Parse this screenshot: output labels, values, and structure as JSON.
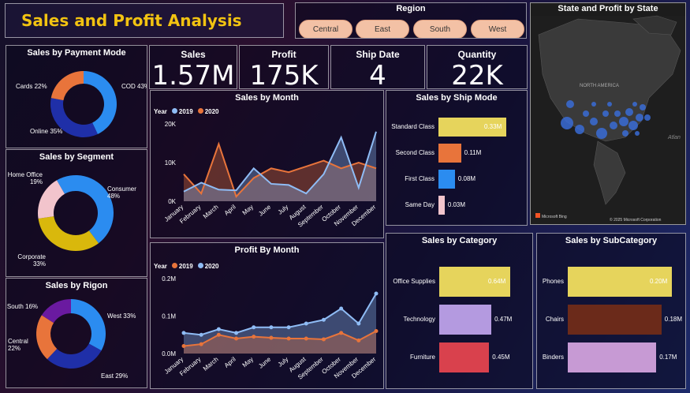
{
  "dashboard_title": "Sales and Profit Analysis",
  "region_slicer": {
    "title": "Region",
    "options": [
      "Central",
      "East",
      "South",
      "West"
    ]
  },
  "kpis": [
    {
      "label": "Sales",
      "value": "1.57M"
    },
    {
      "label": "Profit",
      "value": "175K"
    },
    {
      "label": "Ship Date",
      "value": "4"
    },
    {
      "label": "Quantity",
      "value": "22K"
    }
  ],
  "map": {
    "title": "State and Profit by State",
    "region_label": "NORTH AMERICA",
    "ocean_label": "Atlan",
    "attribution_left": "Microsoft Bing",
    "attribution_right": "© 2025 Microsoft Corporation"
  },
  "chart_data": [
    {
      "id": "payment_mode",
      "type": "pie",
      "title": "Sales by Payment Mode",
      "labels": [
        "COD",
        "Online",
        "Cards"
      ],
      "values": [
        43,
        35,
        22
      ],
      "label_text": [
        "COD 43%",
        "Online 35%",
        "Cards 22%"
      ],
      "colors": [
        "#2b8cf0",
        "#1f2fa8",
        "#e8743b"
      ]
    },
    {
      "id": "segment",
      "type": "pie",
      "title": "Sales by Segment",
      "labels": [
        "Consumer",
        "Corporate",
        "Home Office"
      ],
      "values": [
        48,
        33,
        19
      ],
      "label_text": [
        "Consumer\n48%",
        "Corporate\n33%",
        "Home Office\n19%"
      ],
      "colors": [
        "#2b8cf0",
        "#d9b80c",
        "#f2c4cc"
      ]
    },
    {
      "id": "region",
      "type": "pie",
      "title": "Sales by Rigon",
      "labels": [
        "West",
        "East",
        "Central",
        "South"
      ],
      "values": [
        33,
        29,
        22,
        16
      ],
      "label_text": [
        "West 33%",
        "East 29%",
        "Central\n22%",
        "South 16%"
      ],
      "colors": [
        "#2b8cf0",
        "#1f2fa8",
        "#e8743b",
        "#6a1aa0"
      ]
    },
    {
      "id": "sales_by_month",
      "type": "area",
      "title": "Sales by Month",
      "legend_title": "Year",
      "categories": [
        "January",
        "February",
        "March",
        "April",
        "May",
        "June",
        "July",
        "August",
        "September",
        "October",
        "November",
        "December"
      ],
      "series": [
        {
          "name": "2019",
          "color": "#8fbcf5",
          "values": [
            2500,
            4800,
            3000,
            2800,
            8500,
            4500,
            4200,
            2000,
            7000,
            16500,
            3500,
            18000
          ]
        },
        {
          "name": "2020",
          "color": "#e8743b",
          "values": [
            7000,
            2000,
            14800,
            1200,
            6000,
            8500,
            7500,
            9000,
            10500,
            8500,
            10000,
            8500
          ]
        }
      ],
      "ylim": [
        0,
        20000
      ],
      "y_ticks": [
        "0K",
        "10K",
        "20K"
      ],
      "y_tick_values": [
        0,
        10000,
        20000
      ]
    },
    {
      "id": "profit_by_month",
      "type": "area",
      "title": "Profit By Month",
      "legend_title": "Year",
      "categories": [
        "January",
        "February",
        "March",
        "April",
        "May",
        "June",
        "July",
        "August",
        "September",
        "October",
        "November",
        "December"
      ],
      "series": [
        {
          "name": "2019",
          "color": "#e8743b",
          "values": [
            0.02,
            0.025,
            0.05,
            0.04,
            0.045,
            0.042,
            0.04,
            0.04,
            0.038,
            0.055,
            0.035,
            0.06
          ]
        },
        {
          "name": "2020",
          "color": "#8fbcf5",
          "values": [
            0.055,
            0.05,
            0.065,
            0.055,
            0.07,
            0.07,
            0.07,
            0.08,
            0.09,
            0.12,
            0.08,
            0.16
          ]
        }
      ],
      "ylim": [
        0,
        0.2
      ],
      "y_ticks": [
        "0.0M",
        "0.1M",
        "0.2M"
      ],
      "y_tick_values": [
        0,
        0.1,
        0.2
      ]
    },
    {
      "id": "ship_mode",
      "type": "bar",
      "title": "Sales by Ship Mode",
      "categories": [
        "Standard Class",
        "Second Class",
        "First Class",
        "Same Day"
      ],
      "values": [
        0.33,
        0.11,
        0.08,
        0.03
      ],
      "value_labels": [
        "0.33M",
        "0.11M",
        "0.08M",
        "0.03M"
      ],
      "colors": [
        "#e6d45c",
        "#e8743b",
        "#2b8cf0",
        "#f2c4cc"
      ]
    },
    {
      "id": "category",
      "type": "bar",
      "title": "Sales by Category",
      "categories": [
        "Office Supplies",
        "Technology",
        "Furniture"
      ],
      "values": [
        0.64,
        0.47,
        0.45
      ],
      "value_labels": [
        "0.64M",
        "0.47M",
        "0.45M"
      ],
      "colors": [
        "#e6d45c",
        "#b49ae0",
        "#d9414d"
      ]
    },
    {
      "id": "subcategory",
      "type": "bar",
      "title": "Sales by SubCategory",
      "categories": [
        "Phones",
        "Chairs",
        "Binders"
      ],
      "values": [
        0.2,
        0.18,
        0.17
      ],
      "value_labels": [
        "0.20M",
        "0.18M",
        "0.17M"
      ],
      "colors": [
        "#e6d45c",
        "#6b2a1a",
        "#c79ad4"
      ]
    }
  ]
}
